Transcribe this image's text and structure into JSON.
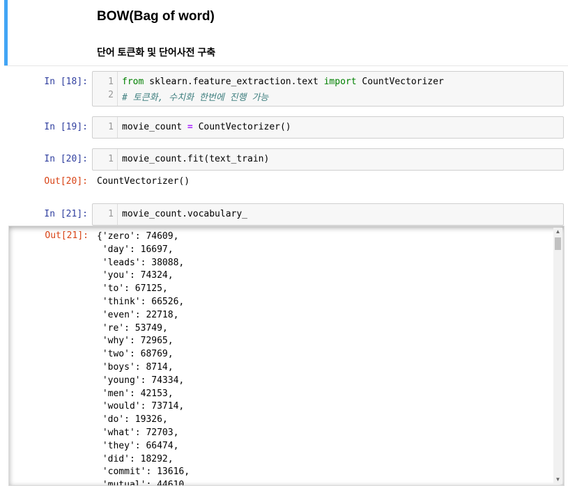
{
  "markdown": {
    "title": "BOW(Bag of word)",
    "subtitle": "단어 토큰화 및 단어사전 구축"
  },
  "cells": [
    {
      "prompt": "In [18]:",
      "lines": [
        {
          "num": "1",
          "kw1": "from",
          "t1": " sklearn.feature_extraction.text ",
          "kw2": "import",
          "t2": " CountVectorizer"
        },
        {
          "num": "2",
          "comment": "# 토큰화, 수치화 한번에 진행 가능"
        }
      ]
    },
    {
      "prompt": "In [19]:",
      "num": "1",
      "pre": "movie_count ",
      "op": "=",
      "post": " CountVectorizer()"
    },
    {
      "prompt": "In [20]:",
      "num": "1",
      "code": "movie_count.fit(text_train)",
      "out_prompt": "Out[20]:",
      "output": "CountVectorizer()"
    },
    {
      "prompt": "In [21]:",
      "num": "1",
      "code": "movie_count.vocabulary_",
      "out_prompt": "Out[21]:"
    }
  ],
  "vocabulary_output": [
    "{'zero': 74609,",
    " 'day': 16697,",
    " 'leads': 38088,",
    " 'you': 74324,",
    " 'to': 67125,",
    " 'think': 66526,",
    " 'even': 22718,",
    " 're': 53749,",
    " 'why': 72965,",
    " 'two': 68769,",
    " 'boys': 8714,",
    " 'young': 74334,",
    " 'men': 42153,",
    " 'would': 73714,",
    " 'do': 19326,",
    " 'what': 72703,",
    " 'they': 66474,",
    " 'did': 18292,",
    " 'commit': 13616,",
    " 'mutual': 44610,"
  ]
}
